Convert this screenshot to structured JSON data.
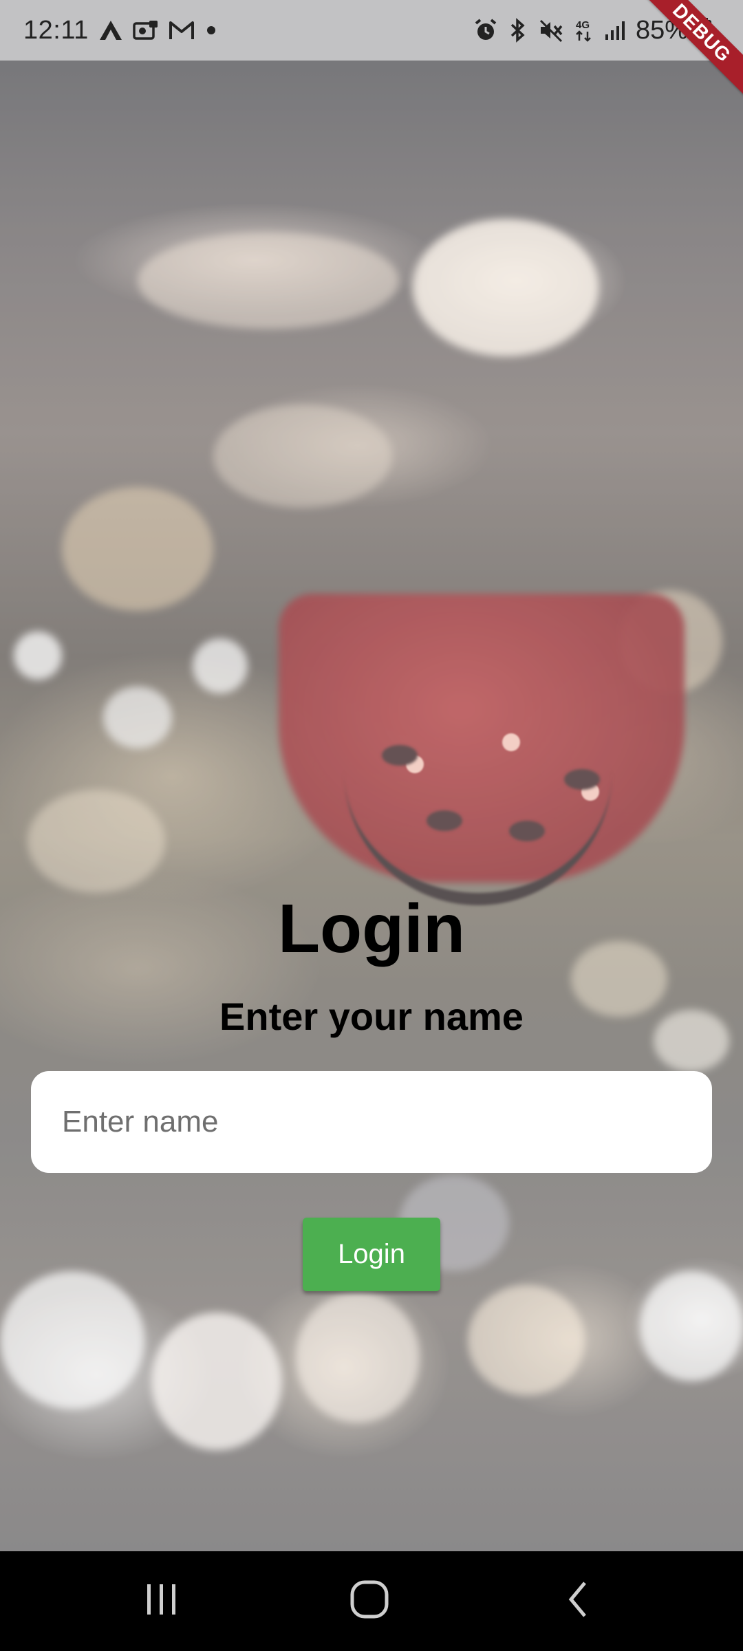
{
  "status_bar": {
    "time": "12:11",
    "notification_icons": [
      "arrow-app-icon",
      "photo-app-icon",
      "gmail-icon",
      "dot-icon"
    ],
    "system_icons": [
      "alarm-icon",
      "bluetooth-icon",
      "mute-icon",
      "4g-icon",
      "signal-icon"
    ],
    "network_label": "4G",
    "battery_text": "85%"
  },
  "debug_banner": {
    "label": "DEBUG",
    "color": "#a81f2a"
  },
  "login": {
    "title": "Login",
    "subtitle": "Enter your name",
    "name_placeholder": "Enter name",
    "name_value": "",
    "button_label": "Login",
    "button_color": "#4caf50"
  },
  "nav_bar": {
    "buttons": [
      "recent-apps-icon",
      "home-icon",
      "back-icon"
    ]
  }
}
